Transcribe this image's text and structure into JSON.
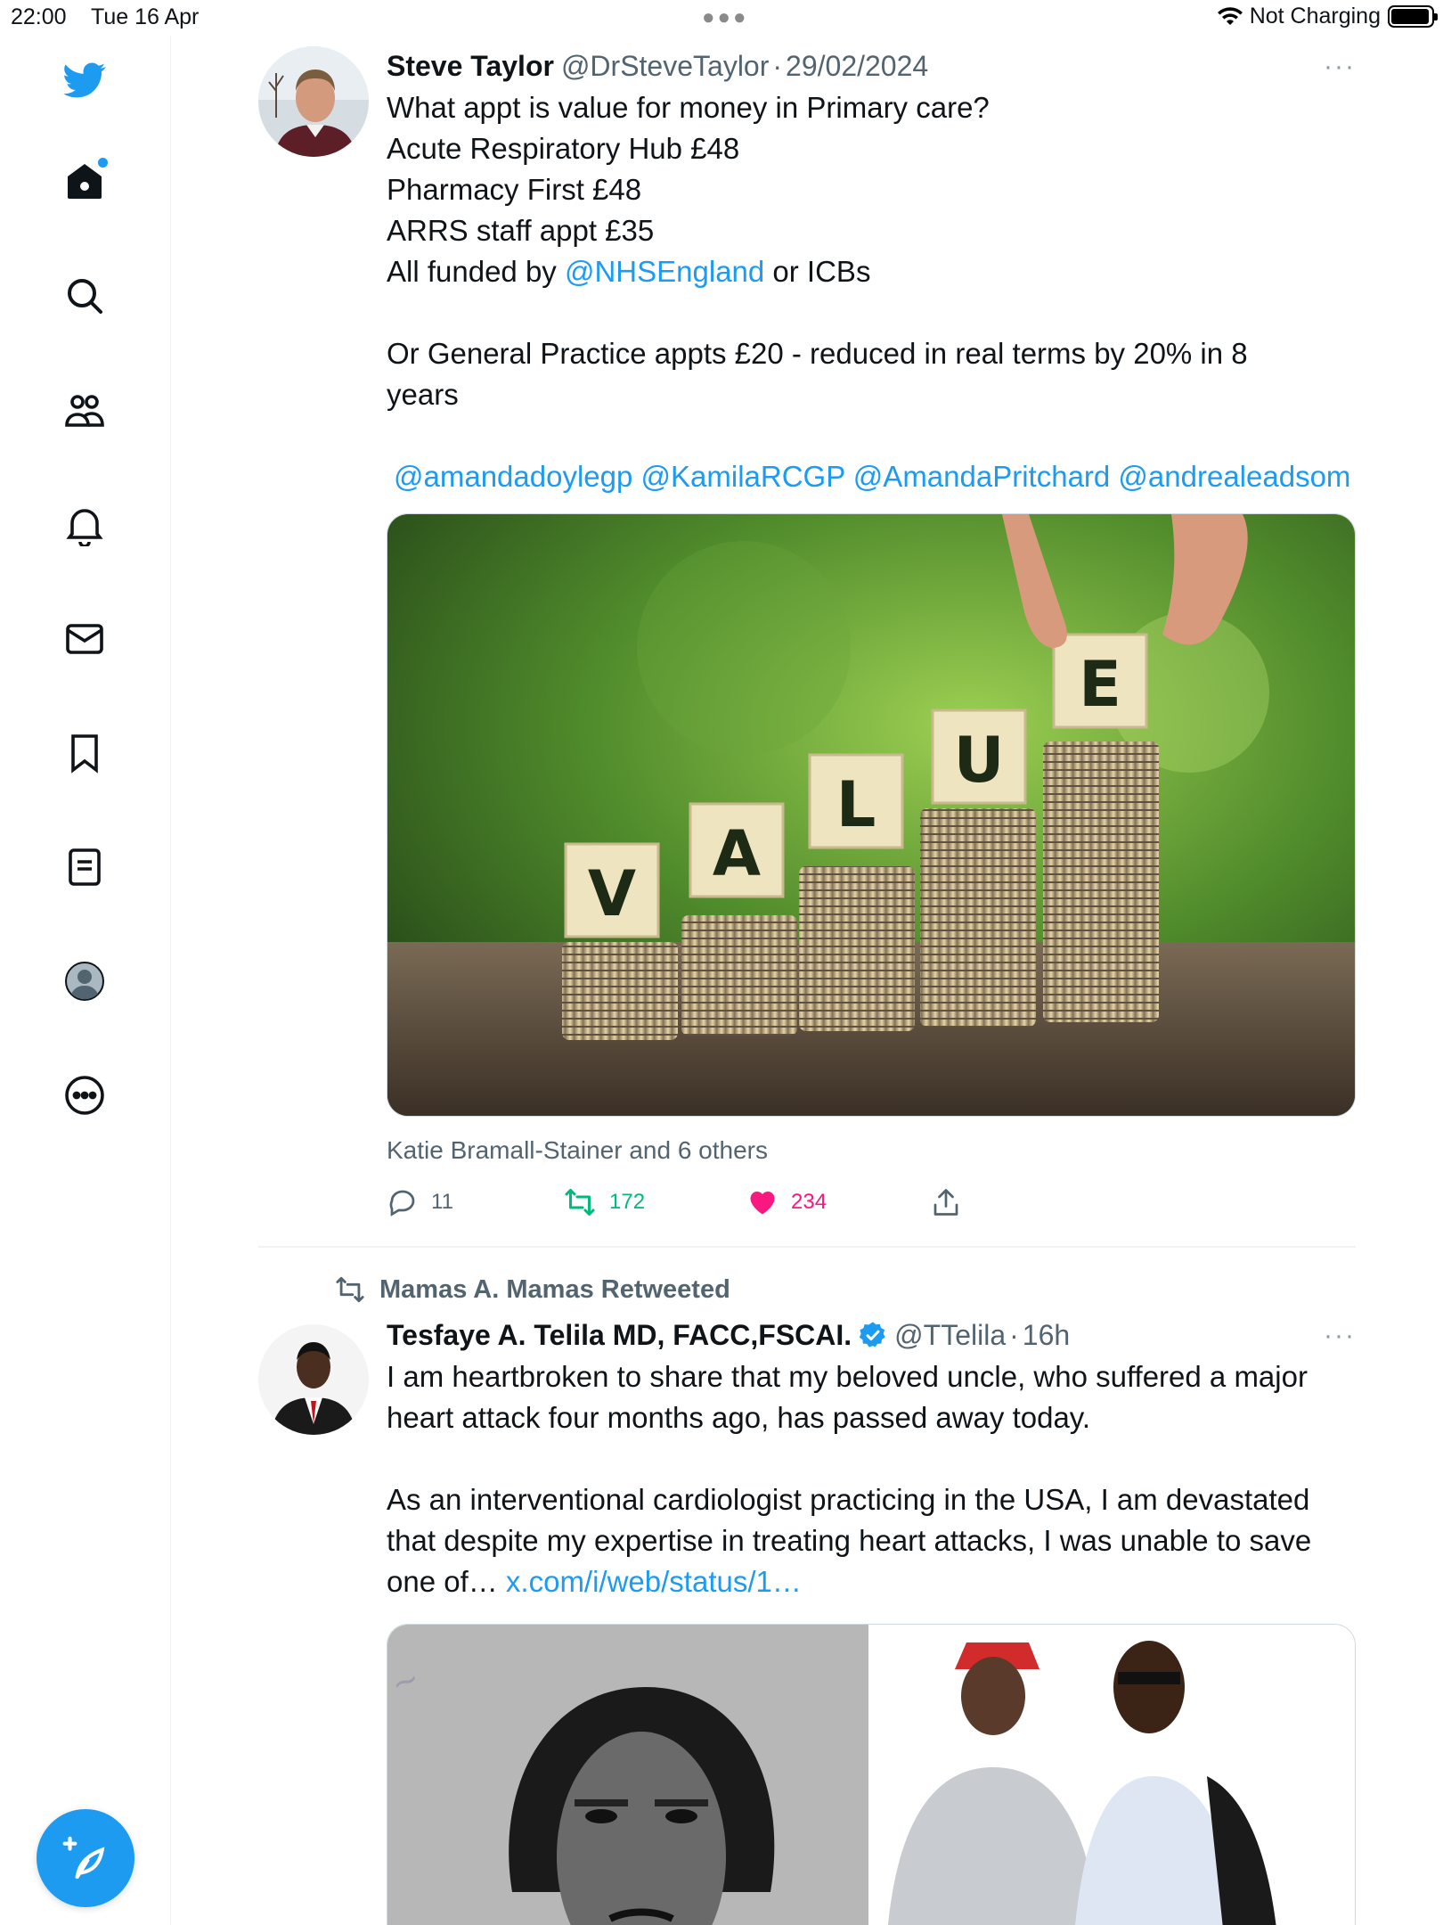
{
  "status_bar": {
    "time": "22:00",
    "date": "Tue 16 Apr",
    "charging": "Not Charging"
  },
  "sidebar": {
    "items": [
      {
        "name": "twitter-logo",
        "icon": "bird-icon"
      },
      {
        "name": "home",
        "icon": "home-icon",
        "has_dot": true
      },
      {
        "name": "explore",
        "icon": "search-icon"
      },
      {
        "name": "communities",
        "icon": "people-icon"
      },
      {
        "name": "notifications",
        "icon": "bell-icon"
      },
      {
        "name": "messages",
        "icon": "mail-icon"
      },
      {
        "name": "bookmarks",
        "icon": "bookmark-icon"
      },
      {
        "name": "lists",
        "icon": "list-icon"
      },
      {
        "name": "profile",
        "icon": "avatar-icon"
      },
      {
        "name": "more",
        "icon": "more-circle-icon"
      }
    ],
    "compose": {
      "icon": "compose-icon"
    }
  },
  "tweet1": {
    "name": "Steve Taylor",
    "handle": "@DrSteveTaylor",
    "separator": "·",
    "time": "29/02/2024",
    "more": "···",
    "lines": [
      "What appt is value for money in Primary care?",
      "Acute Respiratory Hub £48",
      "Pharmacy First £48",
      "ARRS staff appt £35"
    ],
    "funded_prefix": "All funded by ",
    "funded_link": "@NHSEngland",
    "funded_suffix": " or ICBs",
    "gp_line": "Or General Practice appts £20 - reduced in real terms by 20% in 8",
    "gp_line2": "years",
    "mentions": "@amandadoylegp @KamilaRCGP @AmandaPritchard @andrealeadsom",
    "image_letters": [
      "V",
      "A",
      "L",
      "U",
      "E"
    ],
    "liked_by": "Katie Bramall-Stainer and 6 others",
    "replies": "11",
    "retweets": "172",
    "likes": "234"
  },
  "tweet2": {
    "retweeted_by": "Mamas A. Mamas Retweeted",
    "name": "Tesfaye A. Telila MD, FACC,FSCAI.",
    "handle": "@TTelila",
    "separator": "·",
    "time": "16h",
    "more": "···",
    "text1": "I am heartbroken to share that my beloved uncle, who suffered a major heart attack four months ago, has passed away today.",
    "text2": "As an interventional cardiologist practicing in the USA, I am devastated that despite my expertise in treating heart attacks, I was unable to save one of…",
    "link": "x.com/i/web/status/1…"
  },
  "colors": {
    "accent": "#1d9bf0",
    "retweet": "#00ba7c",
    "like": "#f91880",
    "muted": "#536471"
  }
}
